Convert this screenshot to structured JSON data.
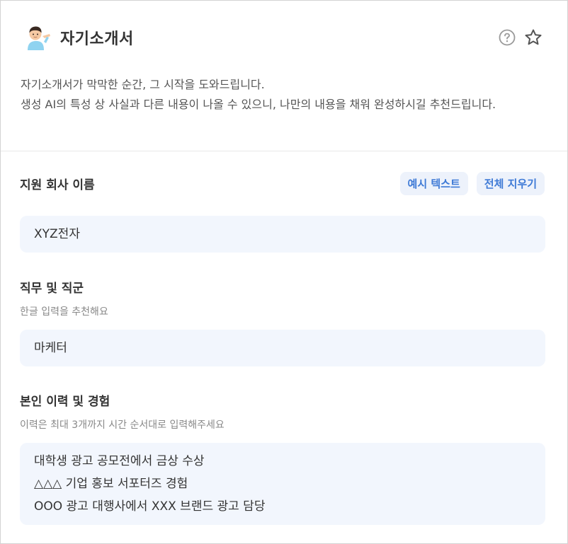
{
  "header": {
    "title": "자기소개서",
    "avatar_icon": "man-tipping-hand-icon",
    "help_icon": "help-circle-icon",
    "favorite_icon": "star-outline-icon"
  },
  "description": {
    "line1": "자기소개서가 막막한 순간, 그 시작을 도와드립니다.",
    "line2": "생성 AI의 특성 상 사실과 다른 내용이 나올 수 있으니, 나만의 내용을 채워 완성하시길 추천드립니다."
  },
  "company_section": {
    "label": "지원 회사 이름",
    "example_button": "예시 텍스트",
    "clear_button": "전체 지우기",
    "value": "XYZ전자"
  },
  "job_section": {
    "label": "직무 및 직군",
    "hint": "한글 입력을 추천해요",
    "value": "마케터"
  },
  "experience_section": {
    "label": "본인 이력 및 경험",
    "hint": "이력은 최대 3개까지 시간 순서대로 입력해주세요",
    "lines": [
      "대학생 광고 공모전에서 금상 수상",
      "△△△ 기업 홍보 서포터즈 경험",
      "OOO 광고 대행사에서 XXX 브랜드 광고 담당"
    ]
  },
  "colors": {
    "accent": "#3e7ad6",
    "field_bg": "#f2f6fd",
    "pill_bg": "#edf2fb"
  }
}
